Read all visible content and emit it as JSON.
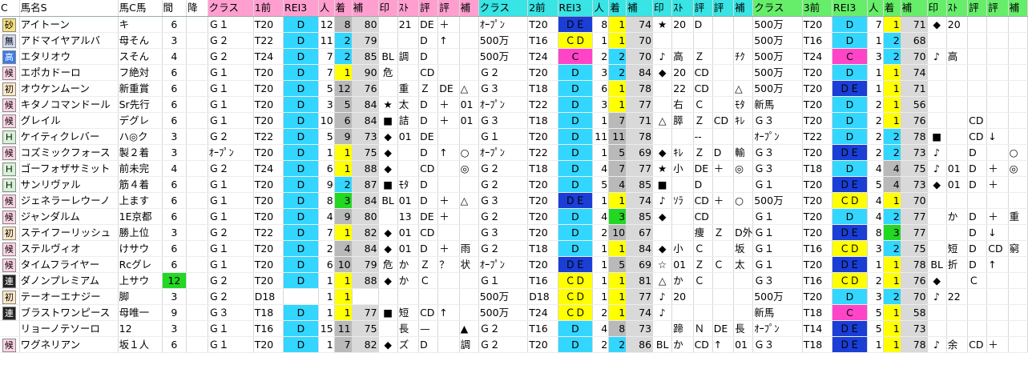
{
  "columns": [
    "C",
    "馬名S",
    "馬C馬",
    "間",
    "降",
    "クラス",
    "1前",
    "REI3",
    "人",
    "着",
    "補",
    "印",
    "ｽﾄ",
    "評",
    "評",
    "補",
    "クラス",
    "2前",
    "REI3",
    "人",
    "着",
    "補",
    "印",
    "ｽﾄ",
    "評",
    "評",
    "補",
    "クラス",
    "3前",
    "REI3",
    "人",
    "着",
    "補",
    "印",
    "ｽﾄ",
    "評",
    "評",
    "補"
  ],
  "rows": [
    {
      "c": "砂",
      "name": "アイトーン",
      "kc": "キ",
      "intv": "6",
      "sec": [
        [
          "Ｇ１",
          "T20",
          "D",
          "12",
          "8",
          "80",
          "",
          "21",
          "DE",
          "＋",
          "",
          ""
        ],
        [
          "ｵｰﾌﾟﾝ",
          "T20",
          "ＤＥ",
          "8",
          "1",
          "74",
          "★",
          "20",
          "D",
          "",
          "",
          ""
        ],
        [
          "500万",
          "T20",
          "D",
          "7",
          "1",
          "71",
          "◆",
          "20",
          "",
          "",
          "",
          ""
        ]
      ]
    },
    {
      "c": "無",
      "name": "アドマイヤアルバ",
      "kc": "母そん",
      "intv": "3",
      "sec": [
        [
          "Ｇ２",
          "T22",
          "D",
          "11",
          "2",
          "79",
          "",
          "",
          "D",
          "↑",
          "",
          ""
        ],
        [
          "500万",
          "T16",
          "ＣＤ",
          "1",
          "1",
          "70",
          "",
          "",
          "",
          "",
          "",
          ""
        ],
        [
          "500万",
          "T16",
          "D",
          "1",
          "2",
          "68",
          "",
          "",
          "",
          "",
          "",
          ""
        ]
      ]
    },
    {
      "c": "高",
      "name": "エタリオウ",
      "kc": "スそん",
      "intv": "4",
      "sec": [
        [
          "Ｇ２",
          "T24",
          "D",
          "7",
          "2",
          "85",
          "BL",
          "調",
          "D",
          "",
          "",
          ""
        ],
        [
          "500万",
          "T24",
          "C",
          "2",
          "2",
          "70",
          "♪",
          "高",
          "Ｚ",
          "",
          "ﾁｸ",
          ""
        ],
        [
          "500万",
          "T24",
          "C",
          "3",
          "2",
          "70",
          "♪",
          "高",
          "",
          "",
          "",
          ""
        ]
      ]
    },
    {
      "c": "候",
      "name": "エポカドーロ",
      "kc": "フ絶対",
      "intv": "6",
      "sec": [
        [
          "Ｇ１",
          "T20",
          "D",
          "7",
          "1",
          "90",
          "危",
          "",
          "CD",
          "",
          "",
          ""
        ],
        [
          "Ｇ２",
          "T20",
          "D",
          "3",
          "2",
          "84",
          "◆",
          "20",
          "CD",
          "",
          "",
          ""
        ],
        [
          "500万",
          "T20",
          "D",
          "1",
          "1",
          "74",
          "",
          "",
          "",
          "",
          "",
          ""
        ]
      ]
    },
    {
      "c": "初",
      "name": "オウケンムーン",
      "kc": "新重賞",
      "intv": "6",
      "sec": [
        [
          "Ｇ１",
          "T20",
          "D",
          "5",
          "12",
          "76",
          "",
          "重",
          "Ｚ",
          "DE",
          "△",
          ""
        ],
        [
          "Ｇ３",
          "T18",
          "D",
          "6",
          "1",
          "78",
          "",
          "22",
          "CD",
          "",
          "△",
          ""
        ],
        [
          "500万",
          "T20",
          "ＤＥ",
          "1",
          "1",
          "71",
          "",
          "",
          "",
          "",
          "",
          ""
        ]
      ]
    },
    {
      "c": "候",
      "name": "キタノコマンドール",
      "kc": "Sr先行",
      "intv": "6",
      "sec": [
        [
          "Ｇ１",
          "T20",
          "D",
          "3",
          "5",
          "84",
          "★",
          "太",
          "D",
          "＋",
          "01",
          ""
        ],
        [
          "ｵｰﾌﾟﾝ",
          "T22",
          "D",
          "3",
          "1",
          "77",
          "",
          "右",
          "Ｃ",
          "",
          "ﾓﾀ",
          ""
        ],
        [
          "新馬",
          "T20",
          "D",
          "2",
          "1",
          "56",
          "",
          "",
          "",
          "",
          "",
          ""
        ]
      ]
    },
    {
      "c": "候",
      "name": "グレイル",
      "kc": "デグレ",
      "intv": "6",
      "sec": [
        [
          "Ｇ１",
          "T20",
          "D",
          "10",
          "6",
          "84",
          "■",
          "詰",
          "D",
          "＋",
          "01",
          ""
        ],
        [
          "Ｇ３",
          "T18",
          "D",
          "1",
          "7",
          "71",
          "△",
          "膵",
          "Ｚ",
          "CD",
          "ｷﾚ",
          ""
        ],
        [
          "Ｇ３",
          "T20",
          "D",
          "2",
          "1",
          "76",
          "",
          "",
          "CD",
          "",
          "",
          ""
        ]
      ]
    },
    {
      "c": "Ｈ",
      "name": "ケイティクレバー",
      "kc": "ハ◎ク",
      "intv": "3",
      "sec": [
        [
          "Ｇ２",
          "T22",
          "D",
          "5",
          "9",
          "73",
          "◆",
          "01",
          "DE",
          "",
          "",
          ""
        ],
        [
          "Ｇ１",
          "T20",
          "D",
          "11",
          "11",
          "78",
          "",
          "",
          "--",
          "",
          "",
          ""
        ],
        [
          "ｵｰﾌﾟﾝ",
          "T22",
          "D",
          "2",
          "2",
          "78",
          "■",
          "",
          "CD",
          "↓",
          "",
          ""
        ]
      ]
    },
    {
      "c": "候",
      "name": "コズミックフォース",
      "kc": "製２着",
      "intv": "3",
      "sec": [
        [
          "ｵｰﾌﾟﾝ",
          "T20",
          "D",
          "1",
          "1",
          "75",
          "◆",
          "",
          "D",
          "↑",
          "○",
          ""
        ],
        [
          "ｵｰﾌﾟﾝ",
          "T22",
          "D",
          "1",
          "5",
          "69",
          "◆",
          "ｷﾚ",
          "Ｚ",
          "D",
          "輸",
          ""
        ],
        [
          "Ｇ３",
          "T20",
          "ＤＥ",
          "2",
          "2",
          "73",
          "♪",
          "",
          "D",
          "",
          "○",
          ""
        ]
      ]
    },
    {
      "c": "Ｈ",
      "name": "ゴーフォザサミット",
      "kc": "前未完",
      "intv": "4",
      "sec": [
        [
          "Ｇ２",
          "T24",
          "D",
          "6",
          "1",
          "88",
          "◆",
          "",
          "CD",
          "",
          "◎",
          ""
        ],
        [
          "Ｇ２",
          "T18",
          "D",
          "4",
          "7",
          "77",
          "★",
          "小",
          "DE",
          "＋",
          "◎",
          ""
        ],
        [
          "Ｇ３",
          "T18",
          "D",
          "4",
          "4",
          "75",
          "♪",
          "01",
          "D",
          "＋",
          "◎",
          ""
        ]
      ]
    },
    {
      "c": "Ｈ",
      "name": "サンリヴァル",
      "kc": "筋４着",
      "intv": "6",
      "sec": [
        [
          "Ｇ１",
          "T20",
          "D",
          "9",
          "2",
          "87",
          "■",
          "ﾓﾀ",
          "D",
          "",
          "",
          ""
        ],
        [
          "Ｇ２",
          "T20",
          "D",
          "5",
          "4",
          "85",
          "■",
          "",
          "D",
          "",
          "",
          ""
        ],
        [
          "Ｇ１",
          "T20",
          "ＤＥ",
          "5",
          "4",
          "73",
          "◆",
          "01",
          "D",
          "＋",
          "",
          ""
        ]
      ]
    },
    {
      "c": "候",
      "name": "ジェネラーレウーノ",
      "kc": "上ます",
      "intv": "6",
      "sec": [
        [
          "Ｇ１",
          "T20",
          "D",
          "8",
          "3",
          "84",
          "BL",
          "01",
          "D",
          "＋",
          "△",
          ""
        ],
        [
          "Ｇ３",
          "T20",
          "ＤＥ",
          "1",
          "1",
          "74",
          "♪",
          "ｿﾗ",
          "CD",
          "＋",
          "○",
          ""
        ],
        [
          "500万",
          "T20",
          "ＣＤ",
          "4",
          "1",
          "70",
          "",
          "",
          "",
          "",
          "",
          ""
        ]
      ]
    },
    {
      "c": "候",
      "name": "ジャンダルム",
      "kc": "1E京都",
      "intv": "6",
      "sec": [
        [
          "Ｇ１",
          "T20",
          "D",
          "4",
          "9",
          "80",
          "",
          "13",
          "DE",
          "＋",
          "",
          ""
        ],
        [
          "Ｇ２",
          "T20",
          "D",
          "4",
          "3",
          "85",
          "◆",
          "",
          "CD",
          "",
          "",
          ""
        ],
        [
          "Ｇ１",
          "T20",
          "D",
          "4",
          "2",
          "77",
          "",
          "か",
          "D",
          "＋",
          "重",
          ""
        ]
      ]
    },
    {
      "c": "初",
      "name": "ステイフーリッシュ",
      "kc": "勝上位",
      "intv": "3",
      "sec": [
        [
          "Ｇ２",
          "T22",
          "D",
          "7",
          "1",
          "82",
          "◆",
          "01",
          "CD",
          "",
          "",
          ""
        ],
        [
          "Ｇ３",
          "T20",
          "D",
          "2",
          "10",
          "67",
          "",
          "",
          "痩",
          "Ｚ",
          "D外",
          ""
        ],
        [
          "Ｇ１",
          "T20",
          "ＤＥ",
          "8",
          "3",
          "77",
          "",
          "",
          "D",
          "↓",
          "",
          ""
        ]
      ]
    },
    {
      "c": "候",
      "name": "ステルヴィオ",
      "kc": "けサウ",
      "intv": "6",
      "sec": [
        [
          "Ｇ１",
          "T20",
          "D",
          "2",
          "4",
          "84",
          "◆",
          "01",
          "D",
          "＋",
          "雨",
          ""
        ],
        [
          "Ｇ２",
          "T18",
          "D",
          "1",
          "1",
          "84",
          "◆",
          "小",
          "Ｃ",
          "",
          "坂",
          ""
        ],
        [
          "Ｇ１",
          "T16",
          "ＣＤ",
          "3",
          "2",
          "75",
          "",
          "短",
          "D",
          "CD",
          "窮",
          ""
        ]
      ]
    },
    {
      "c": "候",
      "name": "タイムフライヤー",
      "kc": "Rcグレ",
      "intv": "6",
      "sec": [
        [
          "Ｇ１",
          "T20",
          "D",
          "6",
          "10",
          "79",
          "危",
          "か",
          "Ｚ",
          "？",
          "状",
          ""
        ],
        [
          "ｵｰﾌﾟﾝ",
          "T20",
          "ＤＥ",
          "1",
          "5",
          "69",
          "☆",
          "01",
          "Ｚ",
          "Ｃ",
          "太",
          ""
        ],
        [
          "Ｇ１",
          "T20",
          "ＤＥ",
          "1",
          "1",
          "78",
          "BL",
          "折",
          "D",
          "↑",
          "",
          ""
        ]
      ]
    },
    {
      "c": "連",
      "name": "ダノンプレミアム",
      "kc": "上サウ",
      "intv": "12",
      "sec": [
        [
          "Ｇ２",
          "T20",
          "D",
          "1",
          "1",
          "88",
          "◆",
          "か",
          "Ｃ",
          "",
          "",
          ""
        ],
        [
          "Ｇ１",
          "T16",
          "ＣＤ",
          "1",
          "1",
          "81",
          "△",
          "か",
          "Ｃ",
          "",
          "",
          ""
        ],
        [
          "Ｇ３",
          "T16",
          "ＣＤ",
          "2",
          "1",
          "76",
          "◆",
          "",
          "Ｃ",
          "",
          "",
          ""
        ]
      ]
    },
    {
      "c": "初",
      "name": "テーオーエナジー",
      "kc": "脚",
      "intv": "3",
      "sec": [
        [
          "Ｇ２",
          "D18",
          "",
          "1",
          "1",
          "",
          "",
          "",
          "",
          "",
          "",
          ""
        ],
        [
          "500万",
          "D18",
          "ＣＤ",
          "1",
          "1",
          "77",
          "♪",
          "20",
          "",
          "",
          "",
          ""
        ],
        [
          "500万",
          "T20",
          "D",
          "3",
          "2",
          "70",
          "♪",
          "22",
          "",
          "",
          "",
          ""
        ]
      ]
    },
    {
      "c": "連",
      "name": "ブラストワンピース",
      "kc": "母唯一",
      "intv": "9",
      "sec": [
        [
          "Ｇ３",
          "T18",
          "D",
          "1",
          "1",
          "77",
          "■",
          "短",
          "CD",
          "↑",
          "",
          ""
        ],
        [
          "500万",
          "T24",
          "ＣＤ",
          "2",
          "1",
          "74",
          "♪",
          "",
          "",
          "",
          "",
          ""
        ],
        [
          "新馬",
          "T18",
          "C",
          "5",
          "1",
          "58",
          "",
          "",
          "",
          "",
          "",
          ""
        ]
      ]
    },
    {
      "c": "",
      "name": "リョーノテソーロ",
      "kc": "12",
      "intv": "3",
      "sec": [
        [
          "Ｇ１",
          "T16",
          "D",
          "15",
          "11",
          "75",
          "",
          "長",
          "—",
          "",
          "▲",
          ""
        ],
        [
          "Ｇ２",
          "T16",
          "D",
          "4",
          "8",
          "73",
          "",
          "蹄",
          "Ｎ",
          "DE",
          "長",
          ""
        ],
        [
          "ｵｰﾌﾟﾝ",
          "T14",
          "ＤＥ",
          "5",
          "1",
          "73",
          "",
          "",
          "",
          "",
          "",
          ""
        ]
      ]
    },
    {
      "c": "候",
      "name": "ワグネリアン",
      "kc": "坂１人",
      "intv": "6",
      "sec": [
        [
          "Ｇ１",
          "T20",
          "D",
          "1",
          "7",
          "82",
          "◆",
          "ズ",
          "D",
          "",
          "調",
          ""
        ],
        [
          "Ｇ２",
          "T20",
          "D",
          "2",
          "2",
          "86",
          "BL",
          "か",
          "CD",
          "↑",
          "01",
          ""
        ],
        [
          "Ｇ３",
          "T18",
          "ＤＥ",
          "1",
          "1",
          "78",
          "♪",
          "余",
          "CD",
          "＋",
          "",
          ""
        ]
      ]
    }
  ]
}
